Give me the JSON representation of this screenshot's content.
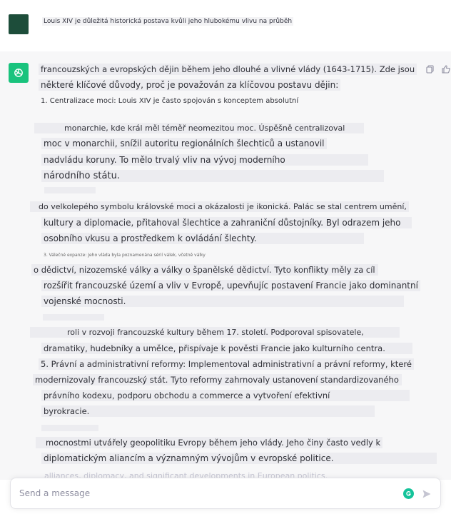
{
  "user_message": {
    "text": "Louis XIV je důležitá historická postava kvůli jeho hlubokému vlivu na průběh"
  },
  "assistant_message": {
    "lines": [
      "francouzských a evropských dějin během jeho dlouhé a vlivné vlády (1643-1715). Zde jsou",
      "některé klíčové důvody, proč je považován za klíčovou postavu dějin:",
      "1. Centralizace moci: Louis XIV je často spojován s konceptem absolutní",
      "monarchie, kde král měl téměř neomezitou moc. Úspěšně centralizoval",
      "moc v monarchii, snížil autoritu regionálních šlechticů a ustanovil",
      "nadvládu koruny. To mělo trvalý vliv na vývoj moderního",
      "národního státu.",
      "do velkolepého symbolu královské moci a okázalosti je ikonická. Palác se stal centrem umění,",
      "kultury a diplomacie, přitahoval šlechtice a zahraniční důstojníky. Byl odrazem jeho",
      "osobního vkusu a prostředkem k ovládání šlechty.",
      "3. Válečné expanze: Jeho vláda byla poznamenána sérií válek, včetně války",
      "o dědictví, nizozemské války a války o španělské dědictví. Tyto konflikty měly za cíl",
      "rozšířit francouzské území a vliv v Evropě, upevňujíc postavení Francie jako dominantní",
      "vojenské mocnosti.",
      "roli v rozvoji francouzské kultury během 17. století. Podporoval spisovatele,",
      "dramatiky, hudebníky a umělce, přispívaje k pověsti Francie jako kulturního centra.",
      "5. Právní a administrativní reformy: Implementoval administrativní a právní reformy, které",
      "modernizovaly francouzský stát. Tyto reformy zahrnovaly ustanovení standardizovaného",
      "právního kodexu, podporu obchodu a commerce a vytvoření efektivní",
      "byrokracie.",
      "mocnostmi utvářely geopolitiku Evropy během jeho vlády. Jeho činy často vedly k",
      "diplomatickým aliancím a významným vývojům v evropské politice.",
      "alliances, diplomacy, and significant developments in European politics."
    ]
  },
  "composer": {
    "placeholder": "Send a message"
  },
  "colors": {
    "assistant_bg": "#f7f7f8",
    "logo_green": "#19c37d",
    "user_avatar": "#1d4d3a",
    "grammarly": "#15c39a"
  },
  "icons": [
    "openai-logo-icon",
    "copy-icon",
    "thumbs-up-icon",
    "grammarly-icon",
    "send-icon"
  ]
}
